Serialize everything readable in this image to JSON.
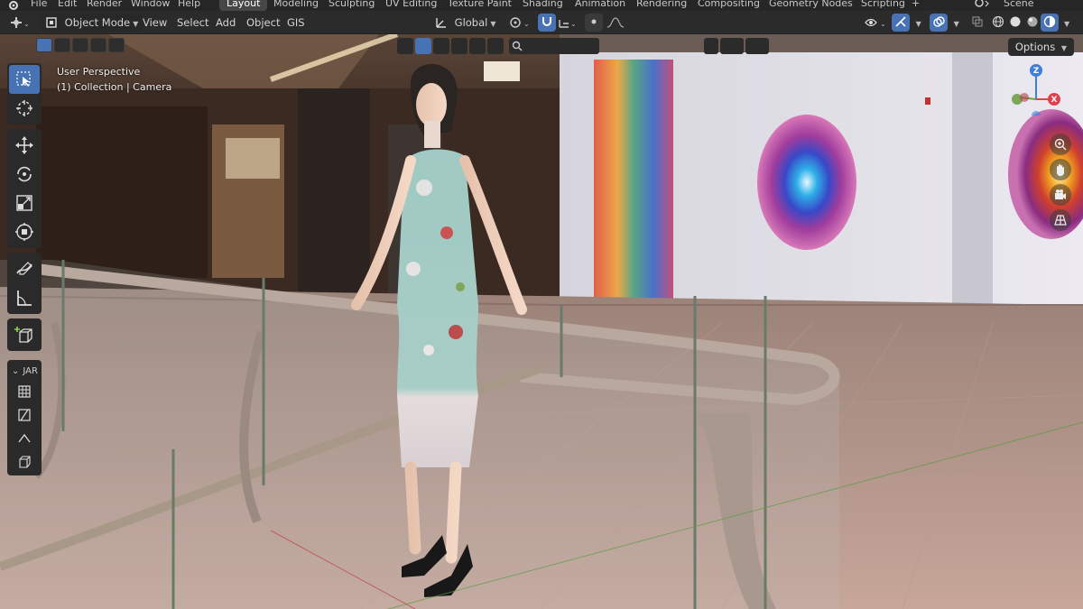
{
  "topbar": {
    "menus": [
      "File",
      "Edit",
      "Render",
      "Window",
      "Help"
    ],
    "workspaces": [
      "Layout",
      "Modeling",
      "Sculpting",
      "UV Editing",
      "Texture Paint",
      "Shading",
      "Animation",
      "Rendering",
      "Compositing",
      "Geometry Nodes",
      "Scripting"
    ],
    "active_workspace": "Layout",
    "add_workspace": "+",
    "scene_label": "Scene"
  },
  "header": {
    "mode": "Object Mode",
    "menus": [
      "View",
      "Select",
      "Add",
      "Object",
      "GIS"
    ],
    "transform_orientation": "Global"
  },
  "viewport": {
    "perspective_label": "User Perspective",
    "collection_label": "(1) Collection | Camera",
    "options_label": "Options"
  },
  "toolbar": {
    "tools": [
      {
        "name": "select-box",
        "active": true
      },
      {
        "name": "cursor"
      },
      {
        "name": "move"
      },
      {
        "name": "rotate"
      },
      {
        "name": "scale"
      },
      {
        "name": "transform"
      },
      {
        "name": "annotate"
      },
      {
        "name": "measure"
      },
      {
        "name": "add-cube"
      }
    ],
    "addon_panel_label": "JAR"
  },
  "gizmo": {
    "x_label": "X",
    "z_label": "Z",
    "colors": {
      "x": "#e0404a",
      "y": "#6fa046",
      "z": "#3d7fdc"
    }
  },
  "colors": {
    "accent": "#4772b3",
    "header_bg": "#2b2b2b",
    "topbar_bg": "#262626"
  }
}
